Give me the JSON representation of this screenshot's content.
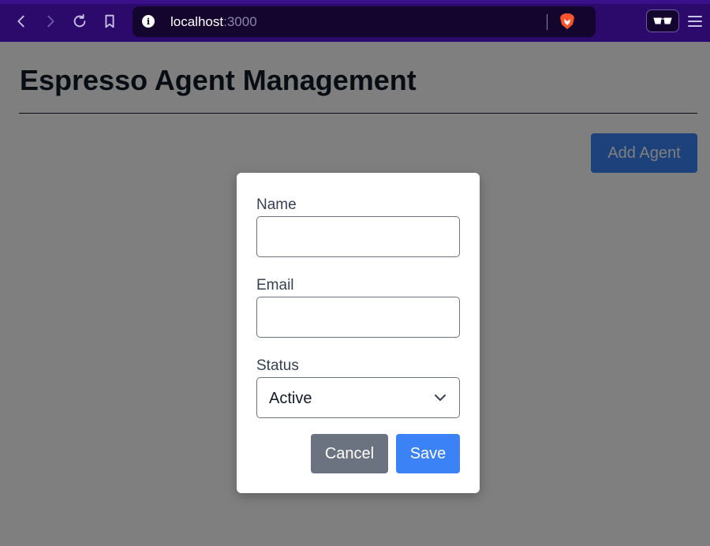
{
  "browser": {
    "url_host": "localhost",
    "url_port": ":3000",
    "icons": [
      "back-icon",
      "forward-icon",
      "reload-icon",
      "bookmark-icon",
      "info-icon",
      "brave-shield-icon",
      "private-glasses-icon",
      "menu-icon"
    ]
  },
  "page": {
    "title": "Espresso Agent Management",
    "add_agent_label": "Add Agent"
  },
  "modal": {
    "name_label": "Name",
    "name_value": "",
    "email_label": "Email",
    "email_value": "",
    "status_label": "Status",
    "status_selected": "Active",
    "cancel_label": "Cancel",
    "save_label": "Save"
  },
  "colors": {
    "chrome_bg": "#2b0a6b",
    "urlbar_bg": "#14052f",
    "primary": "#3b82f6",
    "secondary": "#6b7280",
    "overlay": "rgba(0,0,0,0.5)"
  }
}
